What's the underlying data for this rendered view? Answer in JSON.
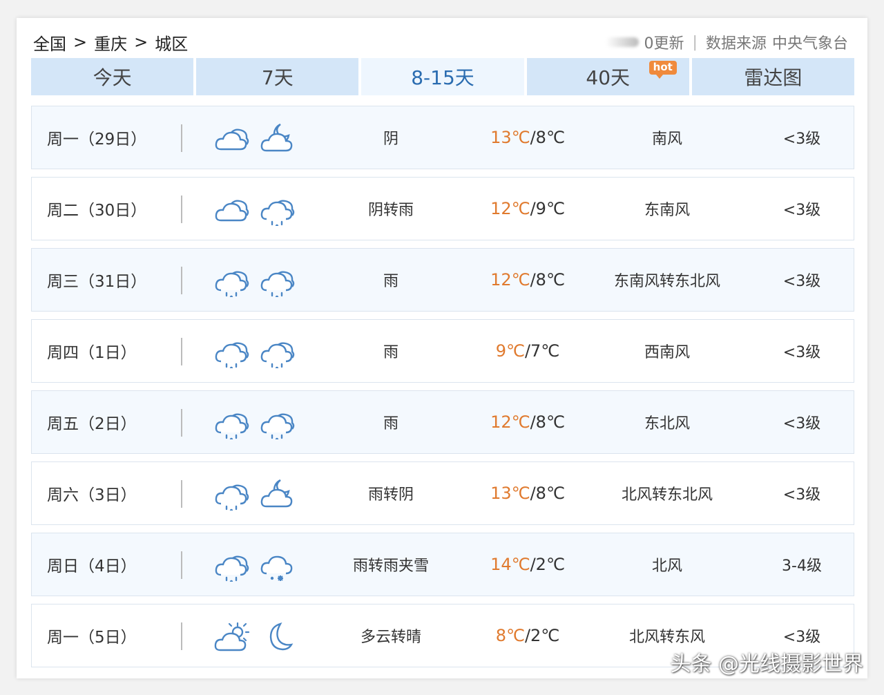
{
  "breadcrumb": {
    "items": [
      "全国",
      "重庆",
      "城区"
    ],
    "separator": ">"
  },
  "source": {
    "update_text": "0更新",
    "label": "数据来源",
    "provider": "中央气象台"
  },
  "tabs": [
    {
      "label": "今天",
      "active": false,
      "badge": ""
    },
    {
      "label": "7天",
      "active": false,
      "badge": ""
    },
    {
      "label": "8-15天",
      "active": true,
      "badge": ""
    },
    {
      "label": "40天",
      "active": false,
      "badge": "hot"
    },
    {
      "label": "雷达图",
      "active": false,
      "badge": ""
    }
  ],
  "rows": [
    {
      "day": "周一（29日）",
      "icons": [
        "cloudy-icon",
        "partly-cloudy-night-icon"
      ],
      "desc": "阴",
      "hi": "13℃",
      "lo": "/8℃",
      "wind": "南风",
      "level": "<3级"
    },
    {
      "day": "周二（30日）",
      "icons": [
        "cloudy-icon",
        "rain-icon"
      ],
      "desc": "阴转雨",
      "hi": "12℃",
      "lo": "/9℃",
      "wind": "东南风",
      "level": "<3级"
    },
    {
      "day": "周三（31日）",
      "icons": [
        "rain-icon",
        "rain-icon"
      ],
      "desc": "雨",
      "hi": "12℃",
      "lo": "/8℃",
      "wind": "东南风转东北风",
      "level": "<3级"
    },
    {
      "day": "周四（1日）",
      "icons": [
        "rain-icon",
        "rain-icon"
      ],
      "desc": "雨",
      "hi": "9℃",
      "lo": "/7℃",
      "wind": "西南风",
      "level": "<3级"
    },
    {
      "day": "周五（2日）",
      "icons": [
        "rain-icon",
        "rain-icon"
      ],
      "desc": "雨",
      "hi": "12℃",
      "lo": "/8℃",
      "wind": "东北风",
      "level": "<3级"
    },
    {
      "day": "周六（3日）",
      "icons": [
        "rain-icon",
        "partly-cloudy-night-icon"
      ],
      "desc": "雨转阴",
      "hi": "13℃",
      "lo": "/8℃",
      "wind": "北风转东北风",
      "level": "<3级"
    },
    {
      "day": "周日（4日）",
      "icons": [
        "rain-icon",
        "sleet-icon"
      ],
      "desc": "雨转雨夹雪",
      "hi": "14℃",
      "lo": "/2℃",
      "wind": "北风",
      "level": "3-4级"
    },
    {
      "day": "周一（5日）",
      "icons": [
        "partly-cloudy-day-icon",
        "moon-icon"
      ],
      "desc": "多云转晴",
      "hi": "8℃",
      "lo": "/2℃",
      "wind": "北风转东风",
      "level": "<3级"
    }
  ],
  "watermark": "头条 @光线摄影世界",
  "colors": {
    "tab_bg": "#d4e6f8",
    "tab_active_bg": "#eef6fe",
    "tab_active_text": "#2a6cb0",
    "temp_high": "#e07a2e",
    "icon": "#4a86c5",
    "hot_badge": "#f08a3c"
  }
}
